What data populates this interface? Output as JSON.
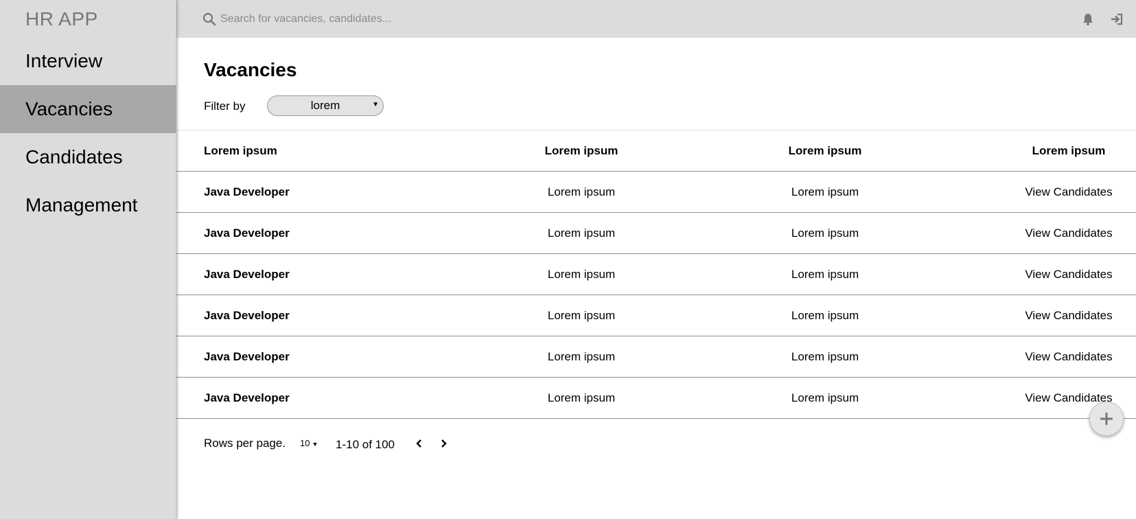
{
  "app": {
    "title": "HR APP"
  },
  "sidebar": {
    "items": [
      {
        "label": "Interview"
      },
      {
        "label": "Vacancies"
      },
      {
        "label": "Candidates"
      },
      {
        "label": "Management"
      }
    ],
    "active_index": 1
  },
  "topbar": {
    "search_placeholder": "Search for vacancies, candidates...",
    "icons": [
      "search-icon",
      "bell-icon",
      "login-icon"
    ]
  },
  "main": {
    "title": "Vacancies",
    "filter": {
      "label": "Filter by",
      "value": "lorem"
    }
  },
  "table": {
    "headers": [
      "Lorem ipsum",
      "Lorem ipsum",
      "Lorem ipsum",
      "Lorem ipsum"
    ],
    "rows": [
      [
        "Java Developer",
        "Lorem ipsum",
        "Lorem ipsum",
        "View Candidates"
      ],
      [
        "Java Developer",
        "Lorem ipsum",
        "Lorem ipsum",
        "View Candidates"
      ],
      [
        "Java Developer",
        "Lorem ipsum",
        "Lorem ipsum",
        "View Candidates"
      ],
      [
        "Java Developer",
        "Lorem ipsum",
        "Lorem ipsum",
        "View Candidates"
      ],
      [
        "Java Developer",
        "Lorem ipsum",
        "Lorem ipsum",
        "View Candidates"
      ],
      [
        "Java Developer",
        "Lorem ipsum",
        "Lorem ipsum",
        "View Candidates"
      ]
    ]
  },
  "pagination": {
    "rows_label": "Rows per page.",
    "rows_value": "10",
    "range": "1-10 of 100"
  },
  "colors": {
    "sidebar_bg": "#dcdcdc",
    "active_bg": "#a8a8a8",
    "topbar_bg": "#dcdcdc"
  }
}
